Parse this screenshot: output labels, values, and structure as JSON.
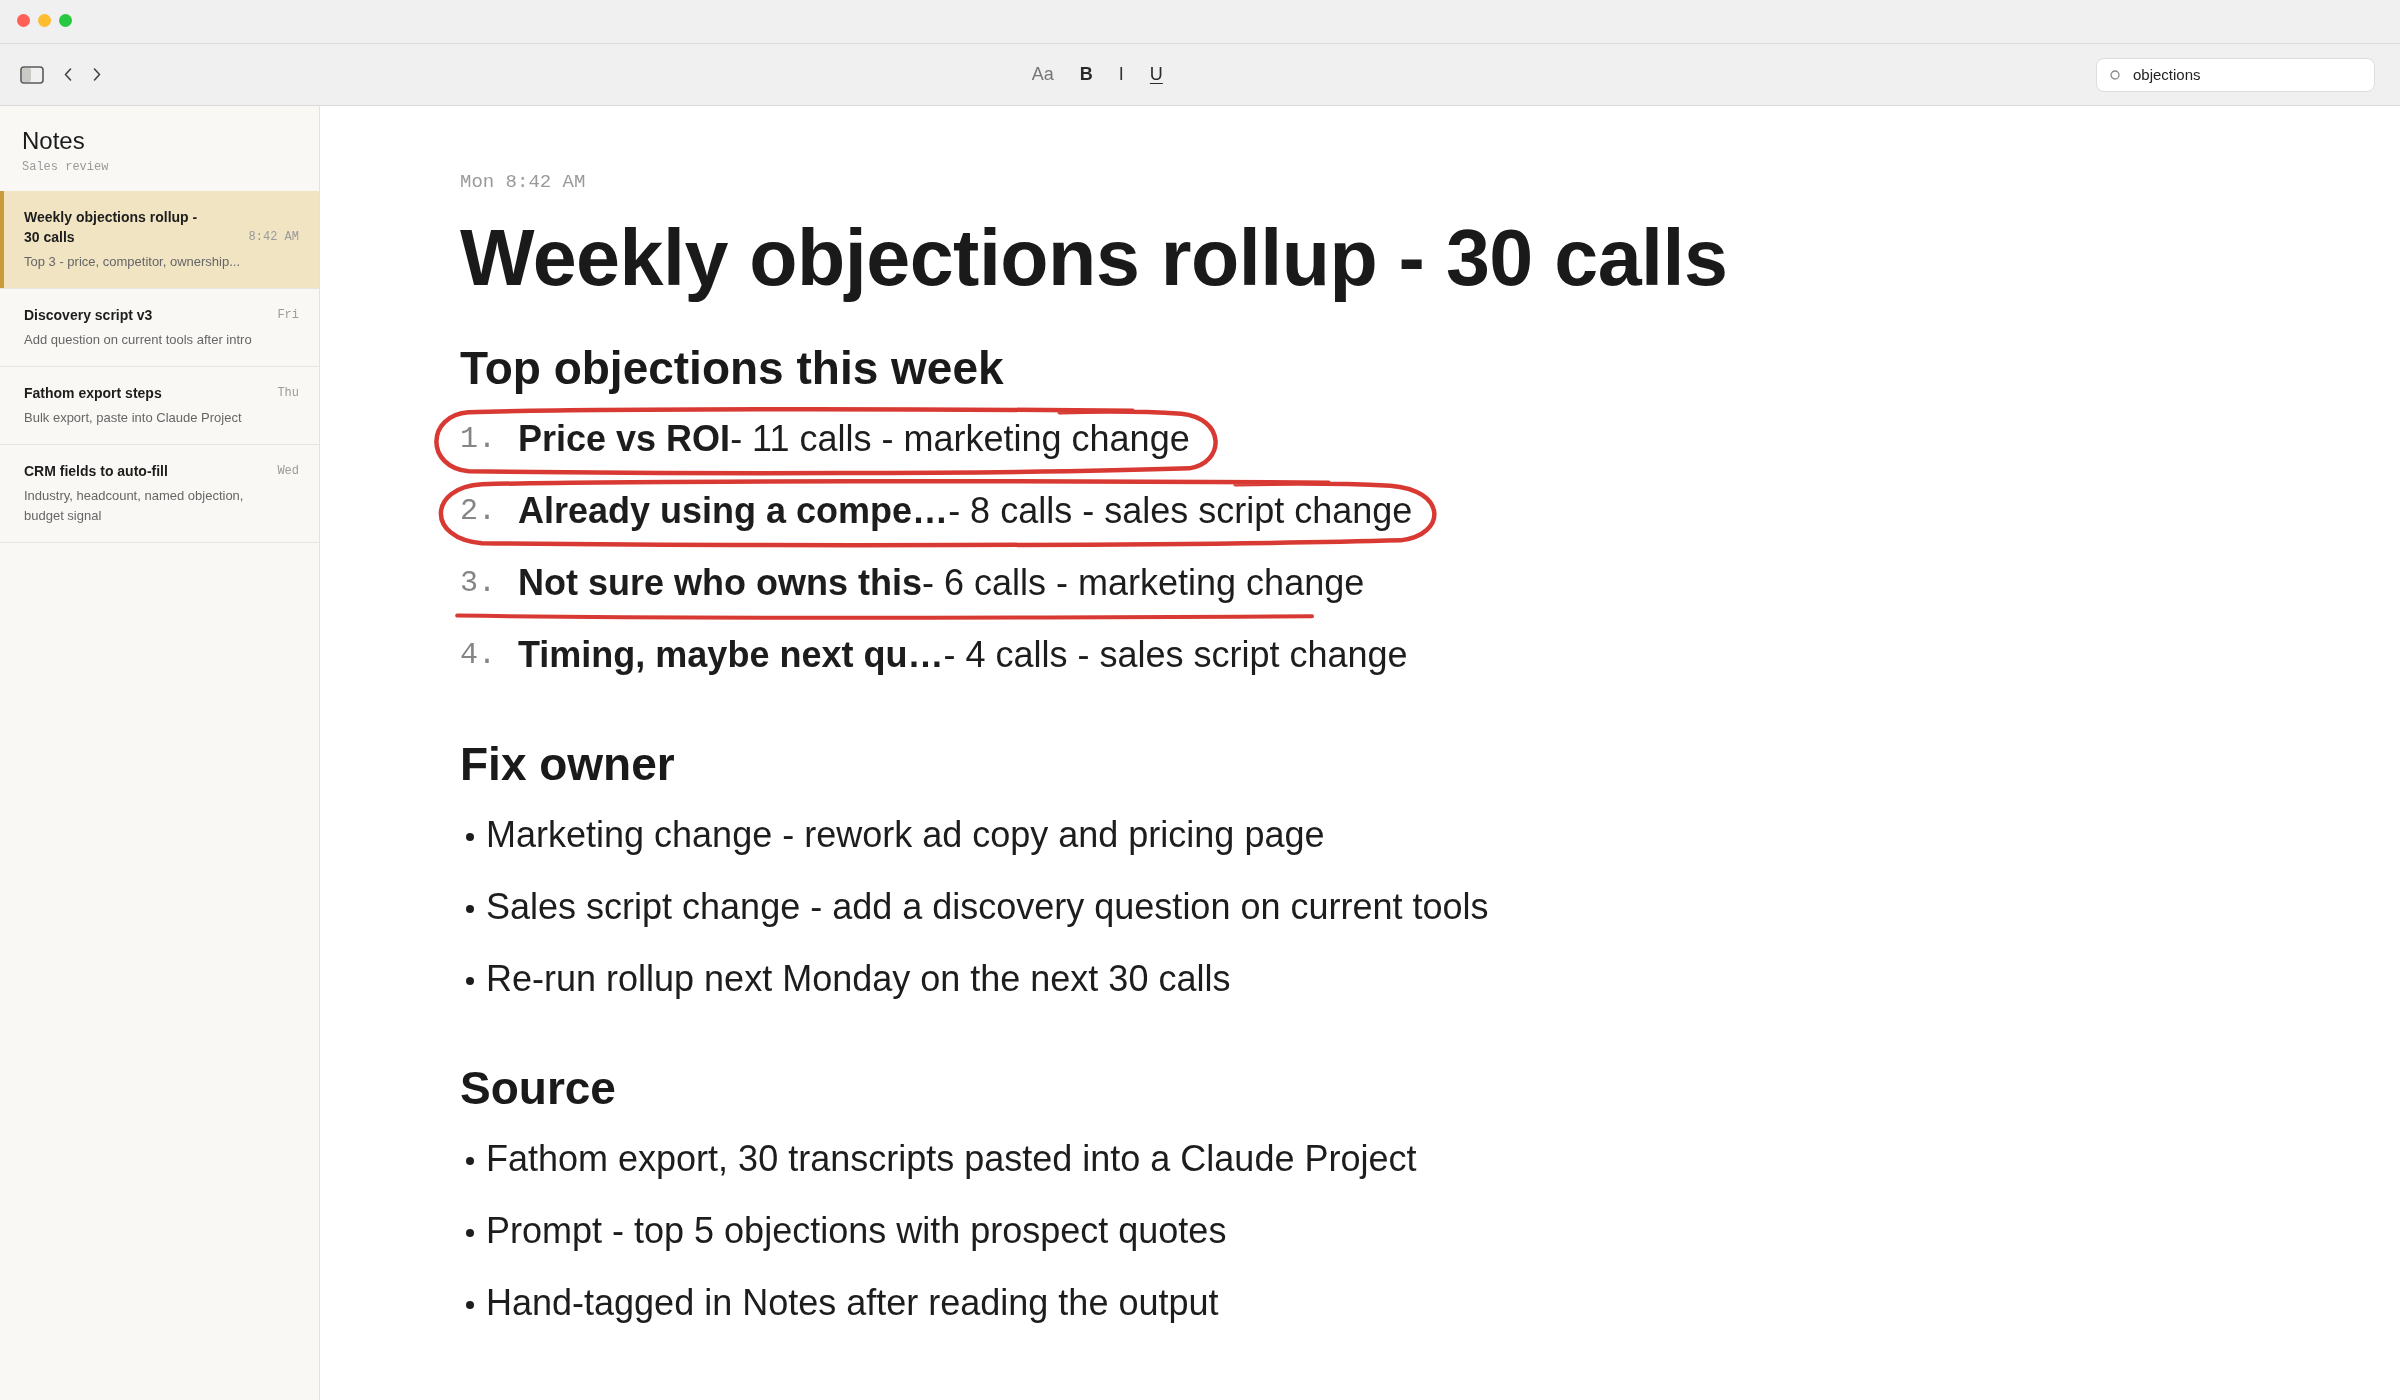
{
  "toolbar": {
    "format_buttons": [
      {
        "label": "Aa",
        "kind": "font"
      },
      {
        "label": "B",
        "kind": "bold"
      },
      {
        "label": "I",
        "kind": "italic"
      },
      {
        "label": "U",
        "kind": "underline"
      }
    ],
    "search": {
      "value": "objections"
    }
  },
  "sidebar": {
    "title": "Notes",
    "subtitle": "Sales review",
    "notes": [
      {
        "title": "Weekly objections rollup - 30 calls",
        "time": "8:42 AM",
        "preview": "Top 3 - price, competitor, ownership...",
        "selected": true
      },
      {
        "title": "Discovery script v3",
        "time": "Fri",
        "preview": "Add question on current tools after intro",
        "selected": false
      },
      {
        "title": "Fathom export steps",
        "time": "Thu",
        "preview": "Bulk export, paste into Claude Project",
        "selected": false
      },
      {
        "title": "CRM fields to auto-fill",
        "time": "Wed",
        "preview": "Industry, headcount, named objection, budget signal",
        "selected": false
      }
    ]
  },
  "note": {
    "date": "Mon 8:42 AM",
    "title": "Weekly objections rollup - 30 calls",
    "sections": [
      {
        "heading": "Top objections this week",
        "kind": "numbered",
        "items": [
          {
            "number": "1.",
            "text": "**Price vs ROI**- 11 calls - marketing change",
            "circled": true,
            "underlined": false
          },
          {
            "number": "2.",
            "text": "**Already using a compe…**- 8 calls - sales script change",
            "circled": true,
            "underlined": false
          },
          {
            "number": "3.",
            "text": "**Not sure who owns this**- 6 calls - marketing change",
            "circled": false,
            "underlined": true
          },
          {
            "number": "4.",
            "text": "**Timing, maybe next qu…**- 4 calls - sales script change",
            "circled": false,
            "underlined": false
          }
        ]
      },
      {
        "heading": "Fix owner",
        "kind": "bulleted",
        "items": [
          {
            "text": "Marketing change - rework ad copy and pricing page"
          },
          {
            "text": "Sales script change - add a discovery question on current tools"
          },
          {
            "text": "Re-run rollup next Monday on the next 30 calls"
          }
        ]
      },
      {
        "heading": "Source",
        "kind": "bulleted",
        "items": [
          {
            "text": "Fathom export, 30 transcripts pasted into a Claude Project"
          },
          {
            "text": "Prompt - top 5 objections with prospect quotes"
          },
          {
            "text": "Hand-tagged in Notes after reading the output"
          }
        ]
      }
    ]
  }
}
